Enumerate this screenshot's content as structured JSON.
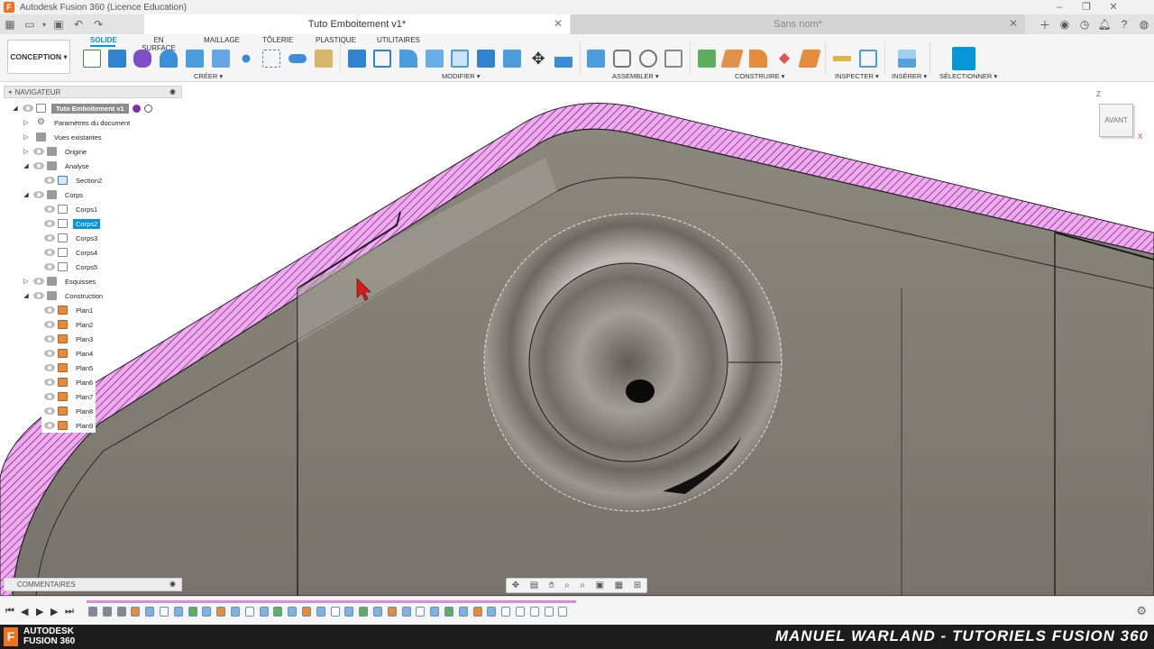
{
  "window": {
    "title": "Autodesk Fusion 360 (Licence Education)"
  },
  "tabs": {
    "active": "Tuto Emboitement v1*",
    "inactive": "Sans nom*"
  },
  "toolbar": {
    "workspace": "CONCEPTION ▾",
    "ribbon_tabs": [
      "SOLIDE",
      "EN SURFACE",
      "MAILLAGE",
      "TÔLERIE",
      "PLASTIQUE",
      "UTILITAIRES"
    ],
    "groups": {
      "creer": "CRÉER ▾",
      "modifier": "MODIFIER ▾",
      "assembler": "ASSEMBLER ▾",
      "construire": "CONSTRUIRE ▾",
      "inspecter": "INSPECTER ▾",
      "inserer": "INSÉRER ▾",
      "selectionner": "SÉLECTIONNER ▾"
    }
  },
  "navigator": {
    "title": "NAVIGATEUR",
    "root": "Tuto Emboitement v1",
    "items": {
      "params": "Paramètres du document",
      "views": "Vues existantes",
      "origin": "Origine",
      "analysis": "Analyse",
      "section": "Section2",
      "bodies": "Corps",
      "corps1": "Corps1",
      "corps2": "Corps2",
      "corps3": "Corps3",
      "corps4": "Corps4",
      "corps5": "Corps5",
      "sketches": "Esquisses",
      "construction": "Construction",
      "plan1": "Plan1",
      "plan2": "Plan2",
      "plan3": "Plan3",
      "plan4": "Plan4",
      "plan5": "Plan5",
      "plan6": "Plan6",
      "plan7": "Plan7",
      "plan8": "Plan8",
      "plan9": "Plan9"
    }
  },
  "viewcube": {
    "face": "AVANT",
    "axis_z": "Z",
    "axis_x": "X"
  },
  "comments": {
    "title": "COMMENTAIRES"
  },
  "footer": {
    "brand_line1": "AUTODESK",
    "brand_line2": "FUSION 360",
    "banner": "MANUEL WARLAND - TUTORIELS FUSION 360"
  },
  "colors": {
    "accent": "#0696d7",
    "section_hatch": "#f0a0f0",
    "model_gray": "#7c7a70",
    "timeline_track": "#d98ad9"
  }
}
